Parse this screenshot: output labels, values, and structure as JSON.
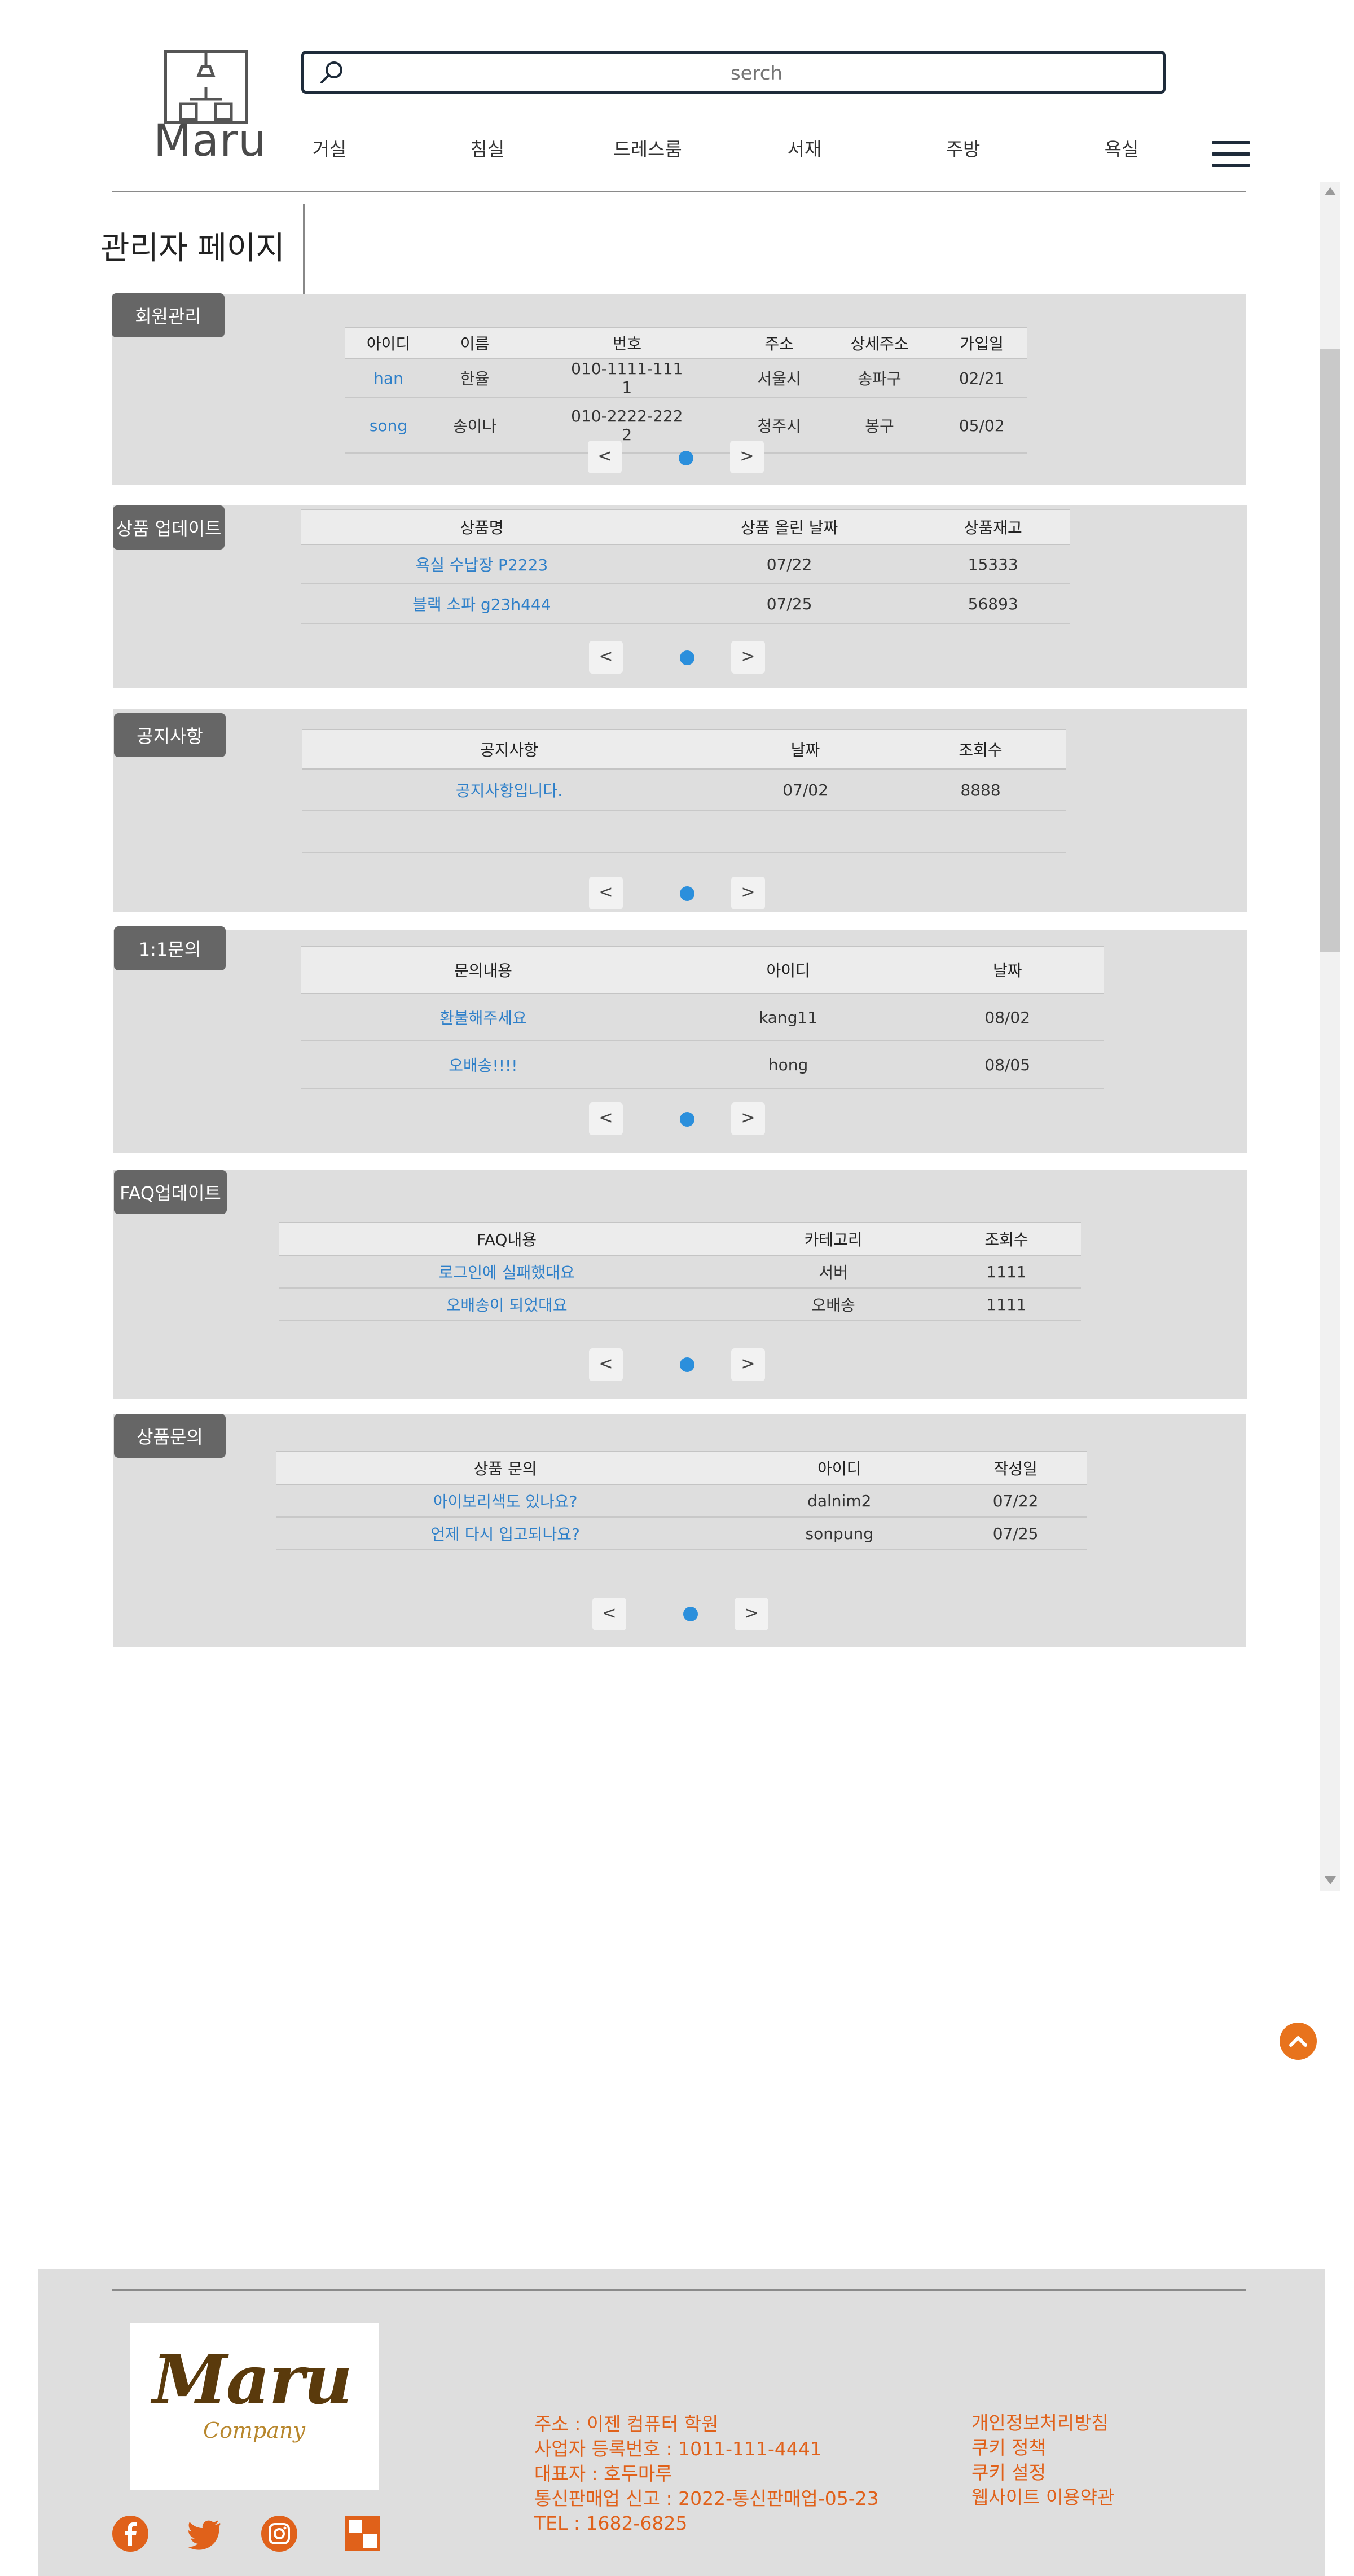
{
  "header": {
    "logo_text": "Maru",
    "search_placeholder": "serch",
    "nav": [
      "거실",
      "침실",
      "드레스룸",
      "서재",
      "주방",
      "욕실"
    ]
  },
  "page_title": "관리자 페이지",
  "members": {
    "label": "회원관리",
    "columns": [
      "아이디",
      "이름",
      "번호",
      "주소",
      "상세주소",
      "가입일"
    ],
    "rows": [
      {
        "id": "han",
        "name": "한율",
        "phone_1": "010-1111-111",
        "phone_2": "1",
        "address": "서울시",
        "detail": "송파구",
        "joined": "02/21"
      },
      {
        "id": "song",
        "name": "송이나",
        "phone_1": "010-2222-222",
        "phone_2": "2",
        "address": "청주시",
        "detail": "봉구",
        "joined": "05/02"
      }
    ]
  },
  "products": {
    "label": "상품 업데이트",
    "columns": [
      "상품명",
      "상품 올린 날짜",
      "상품재고"
    ],
    "rows": [
      {
        "name": "욕실 수납장 P2223",
        "date": "07/22",
        "stock": "15333"
      },
      {
        "name": "블랙 소파 g23h444",
        "date": "07/25",
        "stock": "56893"
      }
    ]
  },
  "notices": {
    "label": "공지사항",
    "columns": [
      "공지사항",
      "날짜",
      "조회수"
    ],
    "rows": [
      {
        "title": "공지사항입니다.",
        "date": "07/02",
        "views": "8888"
      }
    ]
  },
  "inquiries": {
    "label": "1:1문의",
    "columns": [
      "문의내용",
      "아이디",
      "날짜"
    ],
    "rows": [
      {
        "content": "환불해주세요",
        "id": "kang11",
        "date": "08/02"
      },
      {
        "content": "오배송!!!!",
        "id": "hong",
        "date": "08/05"
      }
    ]
  },
  "faq": {
    "label": "FAQ업데이트",
    "columns": [
      "FAQ내용",
      "카테고리",
      "조회수"
    ],
    "rows": [
      {
        "content": "로그인에 실패했대요",
        "category": "서버",
        "views": "1111"
      },
      {
        "content": "오배송이 되었대요",
        "category": "오배송",
        "views": "1111"
      }
    ]
  },
  "product_qna": {
    "label": "상품문의",
    "columns": [
      "상품 문의",
      "아이디",
      "작성일"
    ],
    "rows": [
      {
        "question": "아이보리색도 있나요?",
        "id": "dalnim2",
        "date": "07/22"
      },
      {
        "question": "언제 다시 입고되나요?",
        "id": "sonpung",
        "date": "07/25"
      }
    ]
  },
  "pager": {
    "prev": "<",
    "next": ">"
  },
  "footer": {
    "logo_script": "Maru",
    "logo_sub": "Company",
    "info": [
      "주소 : 이젠 컴퓨터 학원",
      "사업자 등록번호 : 1011-111-4441",
      "대표자 : 호두마루",
      "통신판매업 신고 : 2022-통신판매업-05-23",
      "TEL : 1682-6825"
    ],
    "links": [
      "개인정보처리방침",
      "쿠키 정책",
      "쿠키 설정",
      "웹사이트 이용약관"
    ]
  },
  "colors": {
    "accent": "#e0611a",
    "link": "#2f80c9",
    "section_bg": "#dedede",
    "label_bg": "#666666",
    "dot": "#2b8fdc"
  }
}
